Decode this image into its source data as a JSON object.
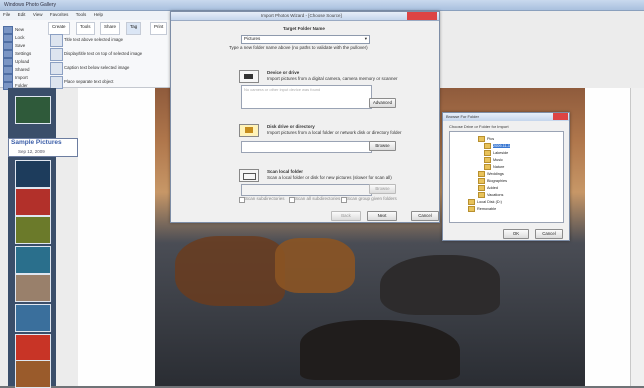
{
  "app": {
    "title": "Windows Photo Gallery",
    "menu": [
      "File",
      "Edit",
      "View",
      "Favorites",
      "Tools",
      "Help"
    ],
    "ribbon_tabs": [
      "Create",
      "Tools",
      "Share",
      "Tag",
      "Print"
    ],
    "ribbon_left": [
      "New",
      "Lock",
      "Save",
      "Settings",
      "Upload",
      "Shared",
      "Import",
      "Folder"
    ],
    "ribbon_groups": [
      "Title text above selected image",
      "Display/title text on top of selected image",
      "Caption text below selected image",
      "Place separate text object"
    ]
  },
  "sample": {
    "title": "Sample Pictures",
    "date": "Sep 12, 2009"
  },
  "thumbnail_colors": [
    "#2f5a3a",
    "#1d3c5c",
    "#b2302a",
    "#6b7a2a",
    "#2a6f8c",
    "#99806b",
    "#3a6f9c",
    "#c83426",
    "#9a5b2b",
    "#d8b21b"
  ],
  "import_dialog": {
    "title": "Import Photos Wizard - [Choose Source]",
    "heading": "Target Folder Name",
    "target_select": "Pictures",
    "target_hint": "Type a new folder name above (no paths to validate with the pullover)",
    "device_title": "Device or drive",
    "device_desc": "Import pictures from a digital camera, camera memory or scanner",
    "device_box_placeholder": "No camera or other input device was found",
    "advanced_button": "Advanced",
    "folder_title": "Disk drive or directory",
    "folder_desc": "Import pictures from a local folder or network disk or directory folder",
    "browse_button_1": "Browse",
    "scan_title": "Scan local folder",
    "scan_desc": "Scan a local folder or disk for new pictures (slower for scan all)",
    "browse_button_2": "Browse",
    "check_1": "Scan subdirectories",
    "check_2": "Scan all subdirectories",
    "check_3": "Scan group given folders",
    "back_button": "Back",
    "next_button": "Next",
    "cancel_button": "Cancel"
  },
  "browse_dialog": {
    "title": "Browse For Folder",
    "prompt": "Choose Drive or Folder for Import",
    "tree": [
      "Pics",
      "2009-11-1",
      "Lakeside",
      "Music",
      "Nature",
      "Weddings",
      "Biographies",
      "Added",
      "Vacations",
      "Local Disk (D:)",
      "Removable"
    ],
    "ok_button": "OK",
    "cancel_button": "Cancel"
  }
}
